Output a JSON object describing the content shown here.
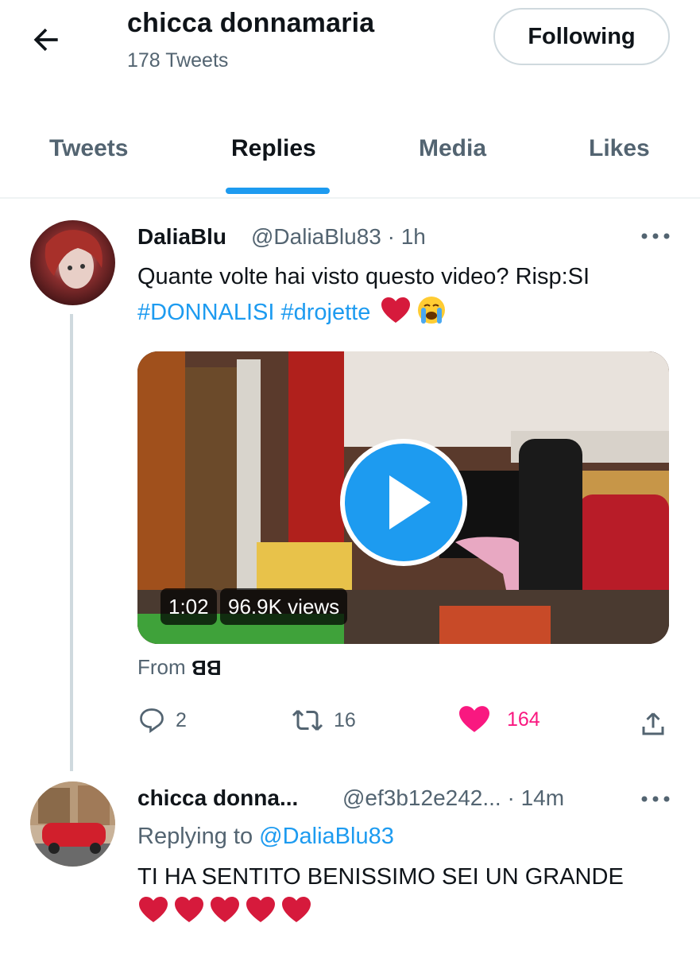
{
  "header": {
    "display_name": "chicca donnamaria",
    "tweet_count": "178 Tweets",
    "follow_label": "Following"
  },
  "tabs": [
    {
      "label": "Tweets",
      "active": false
    },
    {
      "label": "Replies",
      "active": true
    },
    {
      "label": "Media",
      "active": false
    },
    {
      "label": "Likes",
      "active": false
    }
  ],
  "tweets": [
    {
      "name": "DaliaBlu",
      "handle_time": "@DaliaBlu83 · 1h",
      "text_line1": "Quante volte hai visto questo video? Risp:SI",
      "hashtags": "#DONNALISI #drojette",
      "emoji": [
        "red-heart",
        "loudly-crying-face"
      ],
      "video": {
        "duration": "1:02",
        "views": "96.9K views"
      },
      "source_prefix": "From",
      "source_brand": "BB",
      "actions": {
        "replies": "2",
        "retweets": "16",
        "likes": "164"
      }
    },
    {
      "name": "chicca donna...",
      "handle_time": "@ef3b12e242... · 14m",
      "replying_prefix": "Replying to",
      "replying_to": "@DaliaBlu83",
      "text_line1": "TI HA SENTITO BENISSIMO SEI UN GRANDE",
      "emoji": [
        "red-heart",
        "red-heart",
        "red-heart",
        "red-heart",
        "red-heart"
      ]
    }
  ],
  "colors": {
    "accent": "#1d9bf0",
    "like": "#f91880",
    "muted": "#536471",
    "heart": "#d61a3c"
  }
}
